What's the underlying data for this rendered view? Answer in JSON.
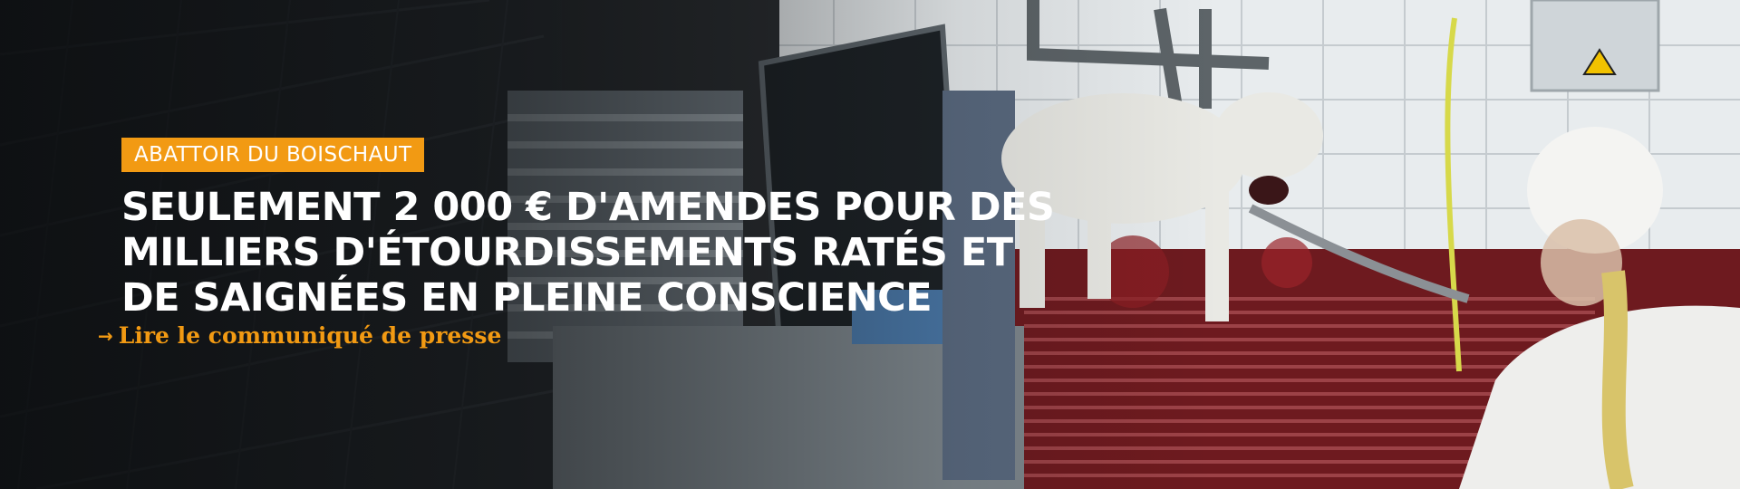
{
  "banner": {
    "tag": "ABATTOIR DU BOISCHAUT",
    "headline_lines": [
      "SEULEMENT 2 000 € D'AMENDES POUR DES",
      "MILLIERS D'ÉTOURDISSEMENTS RATÉS ET",
      "DE SAIGNÉES EN PLEINE CONSCIENCE"
    ],
    "cta_arrow": "→",
    "cta_label": "Lire le communiqué de presse",
    "colors": {
      "accent": "#f29a13",
      "headline": "#ffffff",
      "blood_floor": "#8c1f24",
      "tile_wall": "#e8ecee"
    },
    "icons": {
      "cta_arrow": "arrow-right-icon",
      "warning": "warning-triangle-icon"
    }
  }
}
